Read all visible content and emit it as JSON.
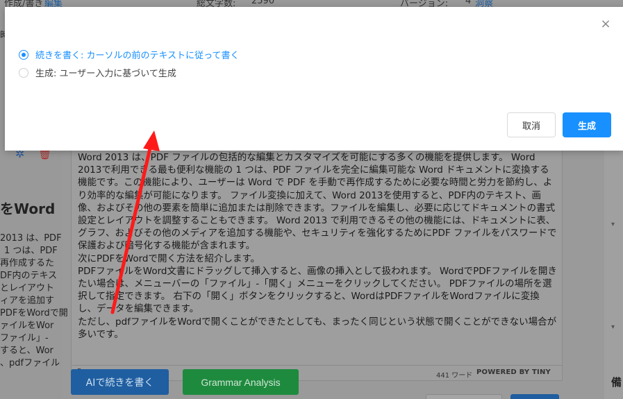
{
  "background": {
    "topbar": {
      "left_fragment": "作成/書き",
      "edit_link": "編集",
      "word_count_label": "総文字数:",
      "word_count_value": "2590",
      "version_label": "バージョン:",
      "version_value": "4",
      "version_link": "洞察"
    },
    "left_edge_texts": [
      "時",
      "をWord",
      "2013 は、PDF",
      "1 つは、PDF",
      "再作成するた",
      "DF内のテキス",
      "とレイアウト",
      "ィアを追加す",
      "PDFをWordで開",
      "ァイルをWor",
      "ファイル」-",
      "すると、Wor",
      "、pdfファイル"
    ],
    "right_label": "備",
    "editor": {
      "paragraphs": [
        "Word 2013 は、PDF ファイルの包括的な編集とカスタマイズを可能にする多くの機能を提供します。 Word 2013で利用できる最も便利な機能の 1 つは、PDF ファイルを完全に編集可能な Word ドキュメントに変換する機能です。この機能により、ユーザーは Word で PDF を手動で再作成するために必要な時間と労力を節約し、より効率的な編集が可能になります。 ファイル変換に加えて、Word 2013を使用すると、PDF内のテキスト、画像、およびその他の要素を簡単に追加または削除できます。ファイルを編集し、必要に応じてドキュメントの書式設定とレイアウトを調整することもできます。 Word 2013 で利用できるその他の機能には、ドキュメントに表、グラフ、およびその他のメディアを追加する機能や、セキュリティを強化するためにPDF ファイルをパスワードで保護および暗号化する機能が含まれます。",
        "次にPDFをWordで開く方法を紹介します。",
        "PDFファイルをWord文書にドラッグして挿入すると、画像の挿入として扱われます。 WordでPDFファイルを開きたい場合は、メニューバーの「ファイル」-「開く」メニューをクリックしてください。 PDFファイルの場所を選択して指定できます。 右下の「開く」ボタンをクリックすると、WordはPDFファイルをWordファイルに変換し、データを編集できます。",
        "ただし、pdfファイルをWordで開くことができたとしても、まったく同じという状態で開くことができない場合が多いです。"
      ],
      "status_path": "P",
      "status_words": "441 ワード",
      "status_powered": "POWERED BY TINY"
    },
    "buttons": {
      "ai_continue": "AIで続きを書く",
      "grammar": "Grammar Analysis"
    }
  },
  "modal": {
    "options": [
      {
        "label": "続きを書く: カーソルの前のテキストに従って書く",
        "checked": true
      },
      {
        "label": "生成: ユーザー入力に基づいて生成",
        "checked": false
      }
    ],
    "cancel_label": "取消",
    "generate_label": "生成",
    "close_icon": "close-icon"
  },
  "colors": {
    "accent": "#1890ff",
    "annotation_arrow": "#ff1a1a"
  }
}
